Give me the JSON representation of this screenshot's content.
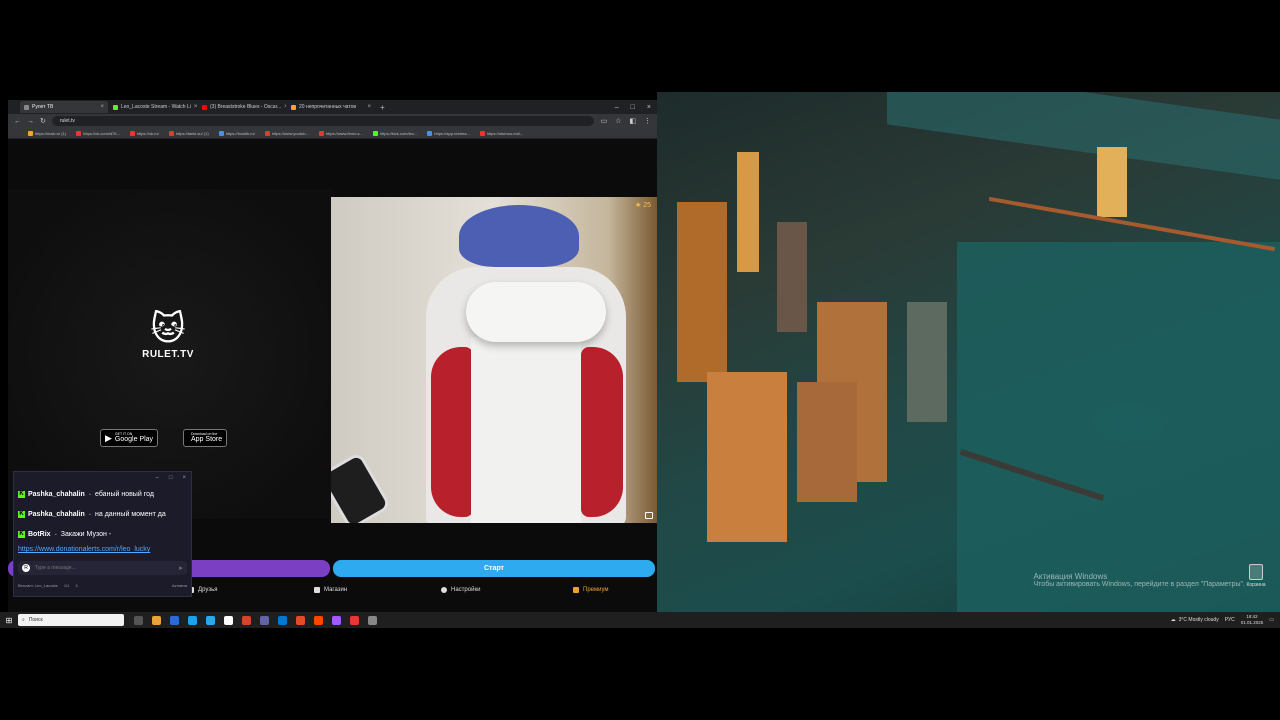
{
  "browser": {
    "tabs": [
      {
        "label": "Рулет ТВ",
        "color": "#888888",
        "active": true
      },
      {
        "label": "Leo_Lacoste Stream - Watch Li",
        "color": "#53fc18",
        "active": false
      },
      {
        "label": "(3) Breaststroke Blues - Oscar...",
        "color": "#ff0000",
        "active": false
      },
      {
        "label": "20 непрочитанных чатов",
        "color": "#f5a623",
        "active": false
      }
    ],
    "new_tab": "+",
    "url": "rulet.tv",
    "bookmarks": [
      {
        "label": "https://mail.ru/ (1)",
        "color": "#f5a623"
      },
      {
        "label": "https://vk.com/id76...",
        "color": "#e33"
      },
      {
        "label": "https://ok.ru/",
        "color": "#e33"
      },
      {
        "label": "https://tanki.su/ (1)",
        "color": "#e33"
      },
      {
        "label": "https://loostik.ru/",
        "color": "#4a90e2"
      },
      {
        "label": "https://www.youtub...",
        "color": "#e33"
      },
      {
        "label": "https://www.ferno.s...",
        "color": "#e33"
      },
      {
        "label": "https://kick.com/leo...",
        "color": "#53fc18"
      },
      {
        "label": "https://app.restrea...",
        "color": "#4a90e2"
      },
      {
        "label": "https://otomoo.md/...",
        "color": "#e33"
      }
    ]
  },
  "site": {
    "logo_text": "RULET.TV",
    "google_play": {
      "small": "GET IT ON",
      "big": "Google Play"
    },
    "app_store": {
      "small": "Download on the",
      "big": "App Store"
    },
    "camera_counter": "★ 25",
    "start_button": "Старт",
    "nav": [
      {
        "label": "Друзья"
      },
      {
        "label": "Магазин"
      },
      {
        "label": "Настройки"
      },
      {
        "label": "Премиум"
      }
    ]
  },
  "chat": {
    "messages": [
      {
        "user": "Pashka_chahalin",
        "text": "ебаный новый год"
      },
      {
        "user": "Pashka_chahalin",
        "text": "на данный момент да"
      },
      {
        "user": "BotRix",
        "text": "Закажи Музон -"
      }
    ],
    "link": "https://www.donationalerts.com/r/leo_lucky",
    "input_placeholder": "Type a message...",
    "avatar_letter": "R",
    "footer_channel": "Benzam: Leo_Lacoste",
    "footer_stats": "1/1",
    "footer_viewers": "3",
    "footer_right": "Активна"
  },
  "desktop": {
    "activation_title": "Активация Windows",
    "activation_text": "Чтобы активировать Windows, перейдите в раздел \"Параметры\".",
    "recycle_bin": "Корзина"
  },
  "taskbar": {
    "search_placeholder": "Поиск",
    "weather": "3°C  Mostly cloudy",
    "lang": "РУС",
    "time": "18:42",
    "date": "01.01.2025",
    "app_colors": [
      "#555555",
      "#e8a33d",
      "#2b6cd4",
      "#1aa3e8",
      "#29a9eb",
      "#ffffff",
      "#d24726",
      "#6264a7",
      "#0078d4",
      "#e34c26",
      "#ff4500",
      "#a259ff",
      "#e33",
      "#888888"
    ]
  }
}
